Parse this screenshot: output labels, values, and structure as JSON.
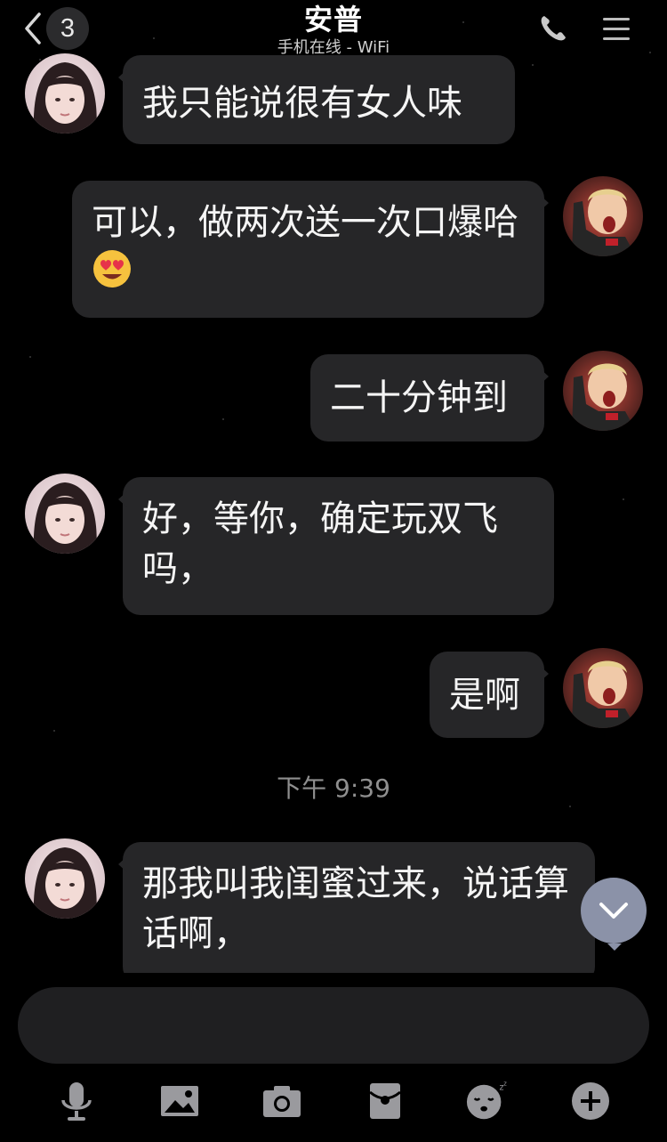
{
  "header": {
    "back_badge_count": "3",
    "title": "安普",
    "subtitle": "手机在线 - WiFi"
  },
  "messages": [
    {
      "side": "in",
      "text": "我只能说很有女人味"
    },
    {
      "side": "out",
      "text": "可以，做两次送一次口爆哈",
      "emoji": "heart-eyes-emoji"
    },
    {
      "side": "out",
      "text": "二十分钟到"
    },
    {
      "side": "in",
      "text": "好，等你，确定玩双飞吗，"
    },
    {
      "side": "out",
      "text": "是啊"
    },
    {
      "side": "in",
      "text": "那我叫我闺蜜过来，说话算话啊，"
    }
  ],
  "timestamp": "下午 9:39",
  "input": {
    "value": "",
    "placeholder": ""
  },
  "toolbar": [
    "microphone-icon",
    "image-icon",
    "camera-icon",
    "red-envelope-icon",
    "sticker-face-icon",
    "plus-icon"
  ],
  "colors": {
    "background": "#000000",
    "bubble": "#262628",
    "scroll_button": "#8b92a8",
    "toolbar_icon": "#9a9a9e"
  }
}
